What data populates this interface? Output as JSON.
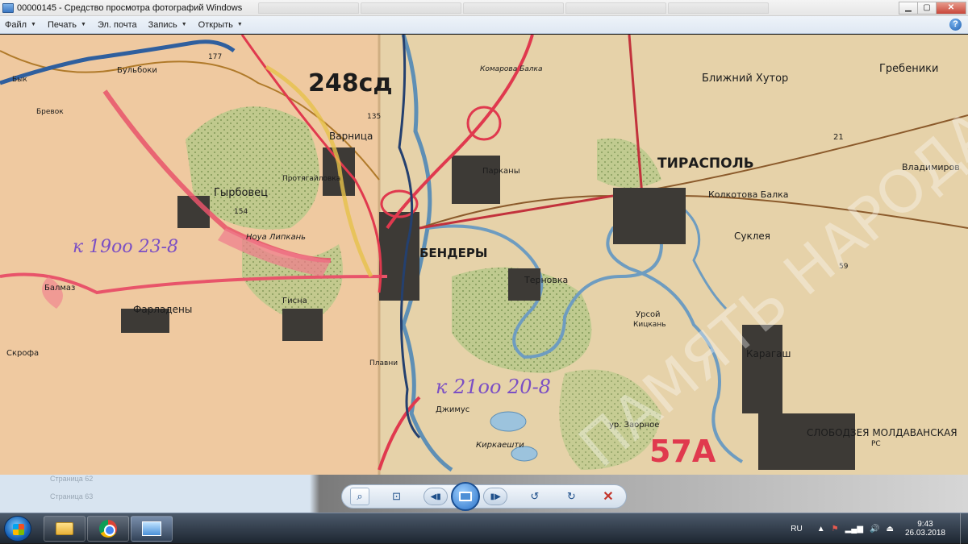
{
  "window": {
    "title": "00000145 - Средство просмотра фотографий Windows",
    "min": "▁",
    "max": "▢",
    "close": "✕"
  },
  "menu": {
    "items": [
      {
        "label": "Файл",
        "arrow": "▼"
      },
      {
        "label": "Печать",
        "arrow": "▼"
      },
      {
        "label": "Эл. почта",
        "arrow": ""
      },
      {
        "label": "Запись",
        "arrow": "▼"
      },
      {
        "label": "Открыть",
        "arrow": "▼"
      }
    ],
    "help": "?"
  },
  "map": {
    "labels": {
      "unit_248": "248сд",
      "bulboki": "Бульбоки",
      "byk": "Бык",
      "brevok": "Бревок",
      "h177": "177",
      "komarova": "Комарова Балка",
      "varnitsa": "Варница",
      "h135": "135",
      "blizhniy": "Ближний Хутор",
      "grebeniki": "Гребеники",
      "tiraspol": "ТИРАСПОЛЬ",
      "vladimirovka": "Владимиров",
      "parkany": "Парканы",
      "protyagailovka": "Протягайловка",
      "gyrbovets": "Гырбовец",
      "h154": "154",
      "kolkotova": "Колкотова Балка",
      "sukleya": "Суклея",
      "noua_lipkany": "Ноуа Липкань",
      "bendery": "БЕНДЕРЫ",
      "ternovka": "Терновка",
      "h59": "59",
      "route_1": "к 19оо 23-8",
      "balmaz": "Балмаз",
      "faradeni": "Фарладены",
      "gisna": "Гисна",
      "ursoy": "Урсой",
      "kitskany": "Кицкань",
      "karagash": "Карагаш",
      "skrofa": "Скрофа",
      "plavni": "Плавни",
      "route_2": "к 21оо 20-8",
      "dzhimus": "Джимус",
      "zaornoe": "ур. Заорное",
      "army_57": "57А",
      "slobozia": "СЛОБОДЗЕЯ МОЛДАВАНСКАЯ",
      "kirkaeshti": "Киркаешти",
      "rs": "РС",
      "watermark": "ПАМЯТЬ НАРОДА",
      "road_21": "21"
    }
  },
  "viewer": {
    "zoom": "⌕",
    "fit": "⊡",
    "prev": "◀▮",
    "next": "▮▶",
    "rotate_ccw": "↺",
    "rotate_cw": "↻",
    "delete": "✕",
    "ghost_lines": [
      "Страница 62",
      "Страница 63"
    ]
  },
  "taskbar": {
    "lang": "RU",
    "time": "9:43",
    "date": "26.03.2018",
    "tray_up": "▲",
    "tray_flag": "⚑",
    "tray_signal": "▂▄▆",
    "tray_volume": "🔊",
    "tray_device": "⏏"
  }
}
